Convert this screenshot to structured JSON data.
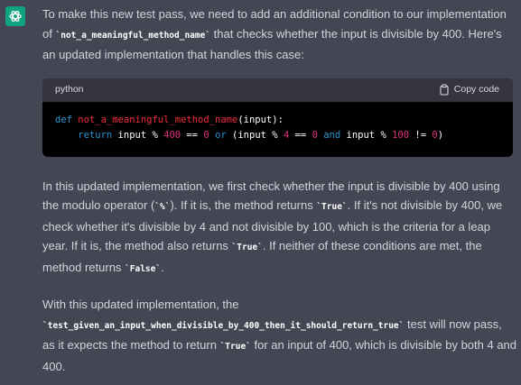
{
  "avatar": {
    "icon": "openai-logo-icon",
    "color": "#10a37f"
  },
  "para1": {
    "t1": "To make this new test pass, we need to add an additional condition to our implementation of ",
    "code1": "`not_a_meaningful_method_name`",
    "t2": " that checks whether the input is divisible by 400. Here's an updated implementation that handles this case:"
  },
  "code_block": {
    "language": "python",
    "copy_label": "Copy code",
    "line1": {
      "kw": "def",
      "fn": "not_a_meaningful_method_name",
      "rest": "(input):"
    },
    "line2": {
      "indent": "    ",
      "kw_return": "return",
      "a": " input % ",
      "n400": "400",
      "b": " == ",
      "n0a": "0",
      "c": " ",
      "kw_or": "or",
      "d": " (input % ",
      "n4": "4",
      "e": " == ",
      "n0b": "0",
      "f": " ",
      "kw_and": "and",
      "g": " input % ",
      "n100": "100",
      "h": " != ",
      "n0c": "0",
      "i": ")"
    }
  },
  "para2": {
    "t1": "In this updated implementation, we first check whether the input is divisible by 400 using the modulo operator (",
    "code1": "`%`",
    "t2": "). If it is, the method returns ",
    "code2": "`True`",
    "t3": ". If it's not divisible by 400, we check whether it's divisible by 4 and not divisible by 100, which is the criteria for a leap year. If it is, the method also returns ",
    "code3": "`True`",
    "t4": ". If neither of these conditions are met, the method returns ",
    "code4": "`False`",
    "t5": "."
  },
  "para3": {
    "t1": "With this updated implementation, the ",
    "code1": "`test_given_an_input_when_divisible_by_400_then_it_should_return_true`",
    "t2": " test will now pass, as it expects the method to return ",
    "code2": "`True`",
    "t3": " for an input of 400, which is divisible by both 4 and 400."
  }
}
